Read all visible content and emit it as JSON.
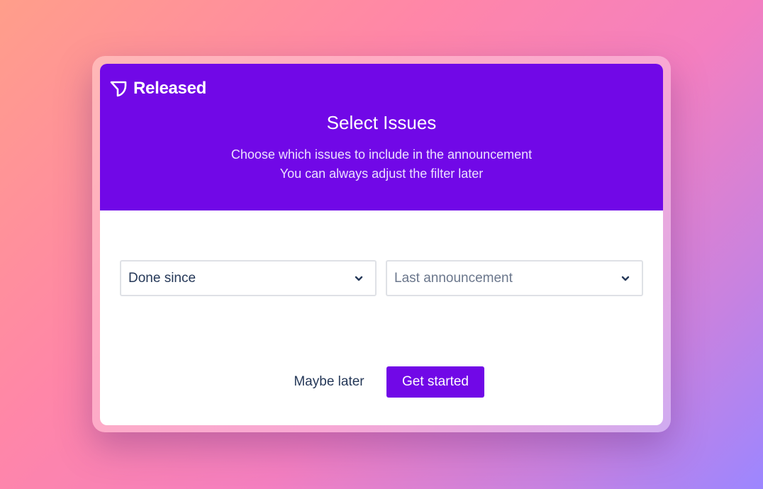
{
  "brand": {
    "name": "Released",
    "accent_color": "#7108e7",
    "logo_icon": "released-logo-icon"
  },
  "dialog": {
    "title": "Select Issues",
    "subtitle_line1": "Choose which issues to include in the announcement",
    "subtitle_line2": "You can always adjust the filter later"
  },
  "filters": {
    "condition_select": {
      "value": "Done since",
      "icon": "chevron-down-icon"
    },
    "reference_select": {
      "placeholder": "Last announcement",
      "icon": "chevron-down-icon"
    }
  },
  "actions": {
    "secondary_label": "Maybe later",
    "primary_label": "Get started"
  }
}
